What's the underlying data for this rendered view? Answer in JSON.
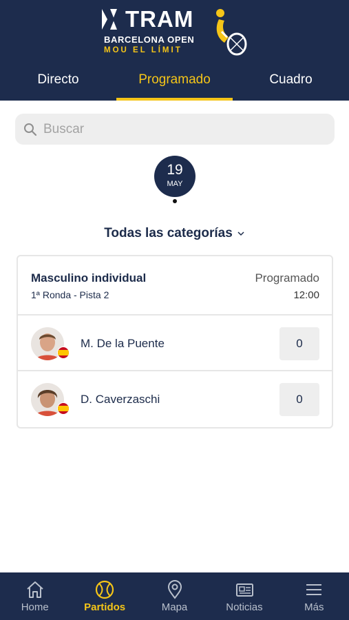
{
  "header": {
    "logo": {
      "brand": "TRAM",
      "event": "BARCELONA OPEN",
      "tagline": "MOU EL LÍMIT"
    },
    "tabs": [
      {
        "label": "Directo",
        "active": false
      },
      {
        "label": "Programado",
        "active": true
      },
      {
        "label": "Cuadro",
        "active": false
      }
    ]
  },
  "search": {
    "placeholder": "Buscar",
    "value": "",
    "icon": "search-icon"
  },
  "date": {
    "day": "19",
    "month": "MAY"
  },
  "category_filter": {
    "label": "Todas las categorías",
    "icon": "chevron-down-icon"
  },
  "match": {
    "category": "Masculino individual",
    "round": "1ª Ronda -  Pista 2",
    "status": "Programado",
    "time": "12:00",
    "players": [
      {
        "name": "M. De la Puente",
        "score": "0",
        "flag": "spain-flag-icon"
      },
      {
        "name": "D. Caverzaschi",
        "score": "0",
        "flag": "spain-flag-icon"
      }
    ]
  },
  "bottom_nav": [
    {
      "label": "Home",
      "icon": "home-icon",
      "active": false
    },
    {
      "label": "Partidos",
      "icon": "tennis-ball-icon",
      "active": true
    },
    {
      "label": "Mapa",
      "icon": "map-pin-icon",
      "active": false
    },
    {
      "label": "Noticias",
      "icon": "newspaper-icon",
      "active": false
    },
    {
      "label": "Más",
      "icon": "menu-icon",
      "active": false
    }
  ],
  "colors": {
    "navy": "#1d2c4d",
    "accent": "#f5c518",
    "inactive_nav": "#b9c0cc",
    "field_bg": "#eeeeee"
  }
}
